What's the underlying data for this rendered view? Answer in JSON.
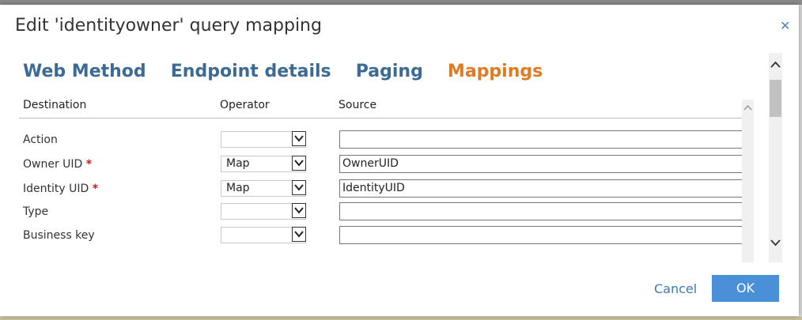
{
  "dialog": {
    "title": "Edit 'identityowner' query mapping",
    "close_icon": "close-icon"
  },
  "tabs": [
    {
      "label": "Web Method",
      "active": false
    },
    {
      "label": "Endpoint details",
      "active": false
    },
    {
      "label": "Paging",
      "active": false
    },
    {
      "label": "Mappings",
      "active": true
    }
  ],
  "table": {
    "headers": {
      "destination": "Destination",
      "operator": "Operator",
      "source": "Source"
    },
    "rows": [
      {
        "destination": "Action",
        "required": false,
        "operator": "",
        "source": ""
      },
      {
        "destination": "Owner UID",
        "required": true,
        "operator": "Map",
        "source": "OwnerUID"
      },
      {
        "destination": "Identity UID",
        "required": true,
        "operator": "Map",
        "source": "IdentityUID"
      },
      {
        "destination": "Type",
        "required": false,
        "operator": "",
        "source": ""
      },
      {
        "destination": "Business key",
        "required": false,
        "operator": "",
        "source": ""
      }
    ],
    "required_marker": "*"
  },
  "footer": {
    "cancel_label": "Cancel",
    "ok_label": "OK"
  },
  "colors": {
    "tab": "#3b6b94",
    "tab_active": "#e07b24",
    "ok_bg": "#4a90d9",
    "required": "#d21e1e"
  }
}
